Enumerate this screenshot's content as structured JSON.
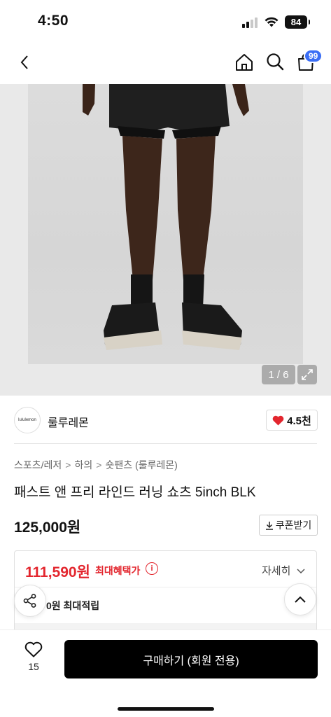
{
  "status": {
    "time": "4:50",
    "battery": "84"
  },
  "nav": {
    "cart_badge": "99"
  },
  "gallery": {
    "page_indicator": "1 / 6"
  },
  "brand": {
    "logo_text": "lululemon",
    "name": "룰루레몬",
    "likes": "4.5천"
  },
  "breadcrumb": [
    "스포츠/레저",
    "하의",
    "숏팬츠 (룰루레몬)"
  ],
  "product": {
    "title": "패스트 앤 프리 라인드 러닝 쇼츠 5inch BLK",
    "price": "125,000원",
    "coupon_label": "쿠폰받기"
  },
  "benefit": {
    "max_price": "111,590원",
    "max_label": "최대혜택가",
    "details": "자세히",
    "points": "0원 최대적립"
  },
  "bottom": {
    "wish_count": "15",
    "buy_label": "구매하기 (회원 전용)"
  },
  "colors": {
    "accent_red": "#e3262e",
    "badge_blue": "#3b6ef5"
  }
}
